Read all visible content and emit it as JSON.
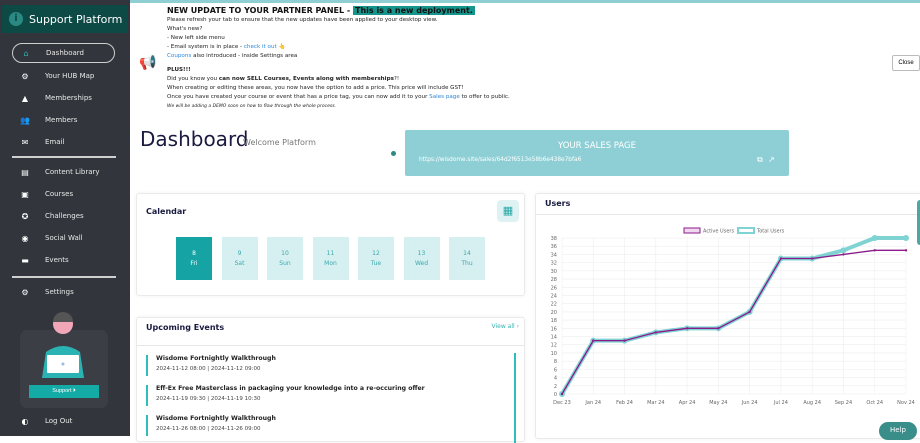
{
  "brand": "Support Platform",
  "sidebar": {
    "items": [
      {
        "label": "Dashboard",
        "icon": "home-icon"
      },
      {
        "label": "Your HUB Map",
        "icon": "gear-map-icon"
      },
      {
        "label": "Memberships",
        "icon": "pyramid-icon"
      },
      {
        "label": "Members",
        "icon": "users-icon"
      },
      {
        "label": "Email",
        "icon": "email-icon"
      },
      {
        "label": "Content Library",
        "icon": "document-icon"
      },
      {
        "label": "Courses",
        "icon": "courses-icon"
      },
      {
        "label": "Challenges",
        "icon": "award-icon"
      },
      {
        "label": "Social Wall",
        "icon": "chat-icon"
      },
      {
        "label": "Events",
        "icon": "events-icon"
      },
      {
        "label": "Settings",
        "icon": "gear-icon"
      }
    ],
    "support": "Support",
    "logout": "Log Out"
  },
  "notice": {
    "title": "NEW UPDATE TO YOUR PARTNER PANEL - ",
    "highlight": "This is a new deployment.",
    "l1": "Please refresh your tab to ensure that the new updates have been applied to your desktop view.",
    "l2": "What's new?",
    "l3": "- New left side menu",
    "l4a": "- Email system is in place - ",
    "l4link": "check it out",
    "l5link": "Coupons",
    "l5b": " also introduced - inside Settings area",
    "plus": "PLUS!!!",
    "l6a": "Did you know you ",
    "l6b": "can now SELL Courses, Events along with memberships",
    "l6c": "?!",
    "l7": "When creating or editing these areas, you now have the option to add a price. This price will include GST!",
    "l8a": "Once you have created your course or event that has a price tag, you can now add it to your ",
    "l8link": "Sales page",
    "l8b": " to offer to public.",
    "l9": "We will be adding a DEMO soon on how to flow through the whole process.",
    "close": "Close"
  },
  "dashboard": {
    "title": "Dashboard",
    "welcome": "Welcome Platform"
  },
  "sales": {
    "title": "YOUR SALES PAGE",
    "url": "https://wisdome.site/sales/64d2f6513e58b6e438e7bfa6"
  },
  "calendar": {
    "title": "Calendar",
    "days": [
      {
        "n": "8",
        "d": "Fri"
      },
      {
        "n": "9",
        "d": "Sat"
      },
      {
        "n": "10",
        "d": "Sun"
      },
      {
        "n": "11",
        "d": "Mon"
      },
      {
        "n": "12",
        "d": "Tue"
      },
      {
        "n": "13",
        "d": "Wed"
      },
      {
        "n": "14",
        "d": "Thu"
      }
    ]
  },
  "events": {
    "title": "Upcoming Events",
    "view_all": "View all ›",
    "items": [
      {
        "name": "Wisdome Fortnightly Walkthrough",
        "time": "2024-11-12 08:00 | 2024-11-12 09:00"
      },
      {
        "name": "Eff-Ex Free Masterclass in packaging your knowledge into a re-occuring offer",
        "time": "2024-11-19 09:30 | 2024-11-19 10:30"
      },
      {
        "name": "Wisdome Fortnightly Walkthrough",
        "time": "2024-11-26 08:00 | 2024-11-26 09:00"
      }
    ]
  },
  "help": "Help",
  "chart_data": {
    "type": "line",
    "title": "Users",
    "categories": [
      "Dec 23",
      "Jan 24",
      "Feb 24",
      "Mar 24",
      "Apr 24",
      "May 24",
      "Jun 24",
      "Jul 24",
      "Aug 24",
      "Sep 24",
      "Oct 24",
      "Nov 24"
    ],
    "series": [
      {
        "name": "Active Users",
        "color": "#8b1a8b",
        "values": [
          0,
          13,
          13,
          15,
          16,
          16,
          20,
          33,
          33,
          34,
          35,
          35
        ]
      },
      {
        "name": "Total Users",
        "color": "#7fd3d3",
        "values": [
          0,
          13,
          13,
          15,
          16,
          16,
          20,
          33,
          33,
          35,
          38,
          38
        ]
      }
    ],
    "ylim": [
      0,
      38
    ],
    "ystep": 2,
    "grid": true,
    "legend": "top"
  }
}
